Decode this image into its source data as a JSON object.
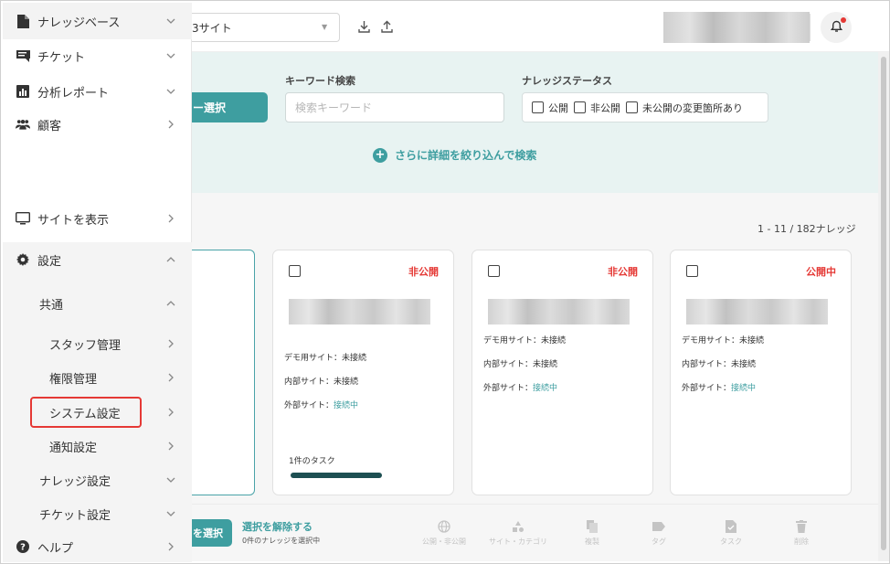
{
  "sidebar": {
    "items": [
      {
        "label": "ナレッジベース",
        "icon": "document-icon"
      },
      {
        "label": "チケット",
        "icon": "ticket-icon"
      },
      {
        "label": "分析レポート",
        "icon": "chart-icon"
      },
      {
        "label": "顧客",
        "icon": "users-icon"
      },
      {
        "label": "サイトを表示",
        "icon": "monitor-icon"
      },
      {
        "label": "設定",
        "icon": "gear-icon"
      },
      {
        "label": "共通"
      },
      {
        "label": "スタッフ管理"
      },
      {
        "label": "権限管理"
      },
      {
        "label": "システム設定"
      },
      {
        "label": "通知設定"
      },
      {
        "label": "ナレッジ設定"
      },
      {
        "label": "チケット設定"
      },
      {
        "label": "ヘルプ",
        "icon": "help-icon"
      }
    ]
  },
  "header": {
    "site_select_value": "3サイト"
  },
  "search": {
    "category_button": "ー選択",
    "keyword_label": "キーワード検索",
    "keyword_placeholder": "検索キーワード",
    "status_label": "ナレッジステータス",
    "status_options": [
      "公開",
      "非公開",
      "未公開の変更箇所あり"
    ],
    "advanced_search": "さらに詳細を絞り込んで検索"
  },
  "list": {
    "count_text": "1 - 11 / 182ナレッジ",
    "cards": [
      {
        "status": "非公開",
        "lines": [
          {
            "label": "デモ用サイト：",
            "value": "未接続"
          },
          {
            "label": "内部サイト：",
            "value": "未接続"
          },
          {
            "label": "外部サイト：",
            "value": "接続中"
          }
        ],
        "task_text": "1件のタスク"
      },
      {
        "status": "非公開",
        "lines": [
          {
            "label": "デモ用サイト：",
            "value": "未接続"
          },
          {
            "label": "内部サイト：",
            "value": "未接続"
          },
          {
            "label": "外部サイト：",
            "value": "接続中"
          }
        ]
      },
      {
        "status": "公開中",
        "lines": [
          {
            "label": "デモ用サイト：",
            "value": "未接続"
          },
          {
            "label": "内部サイト：",
            "value": "未接続"
          },
          {
            "label": "外部サイト：",
            "value": "接続中"
          }
        ]
      }
    ]
  },
  "bottom_bar": {
    "select_all": "を選択",
    "deselect": "選択を解除する",
    "selected_count": "0件のナレッジを選択中",
    "actions": [
      {
        "label": "公開・非公開",
        "icon": "globe-icon"
      },
      {
        "label": "サイト・カテゴリ",
        "icon": "category-icon"
      },
      {
        "label": "複製",
        "icon": "copy-icon"
      },
      {
        "label": "タグ",
        "icon": "tag-icon"
      },
      {
        "label": "タスク",
        "icon": "task-icon"
      },
      {
        "label": "削除",
        "icon": "trash-icon"
      }
    ]
  },
  "colors": {
    "accent": "#3e9ea0",
    "danger": "#e53935",
    "search_panel_bg": "#e8f3f2",
    "task_bar": "#1d4f52"
  }
}
